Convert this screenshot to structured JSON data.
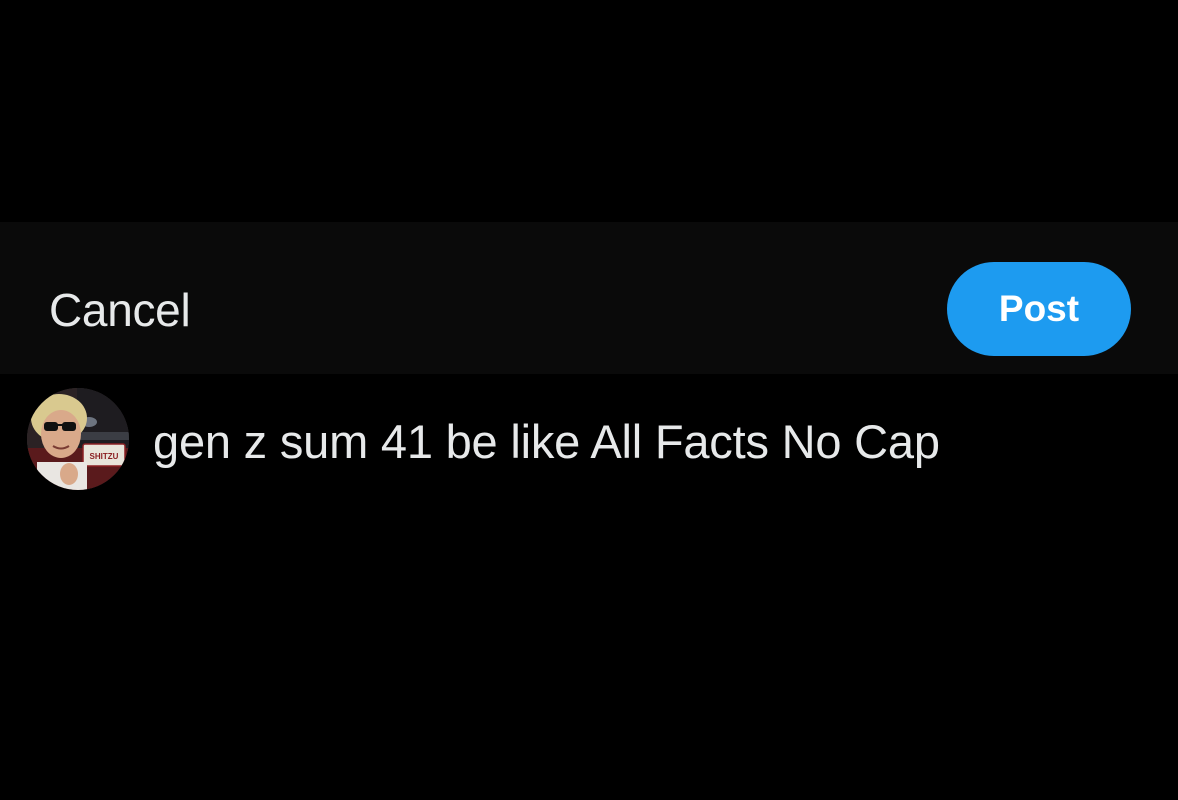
{
  "composer": {
    "cancel_label": "Cancel",
    "post_label": "Post",
    "post_color": "#1d9bf0",
    "text": "gen z sum 41 be like All Facts No Cap"
  },
  "avatar": {
    "plate_text": "SHITZU"
  }
}
